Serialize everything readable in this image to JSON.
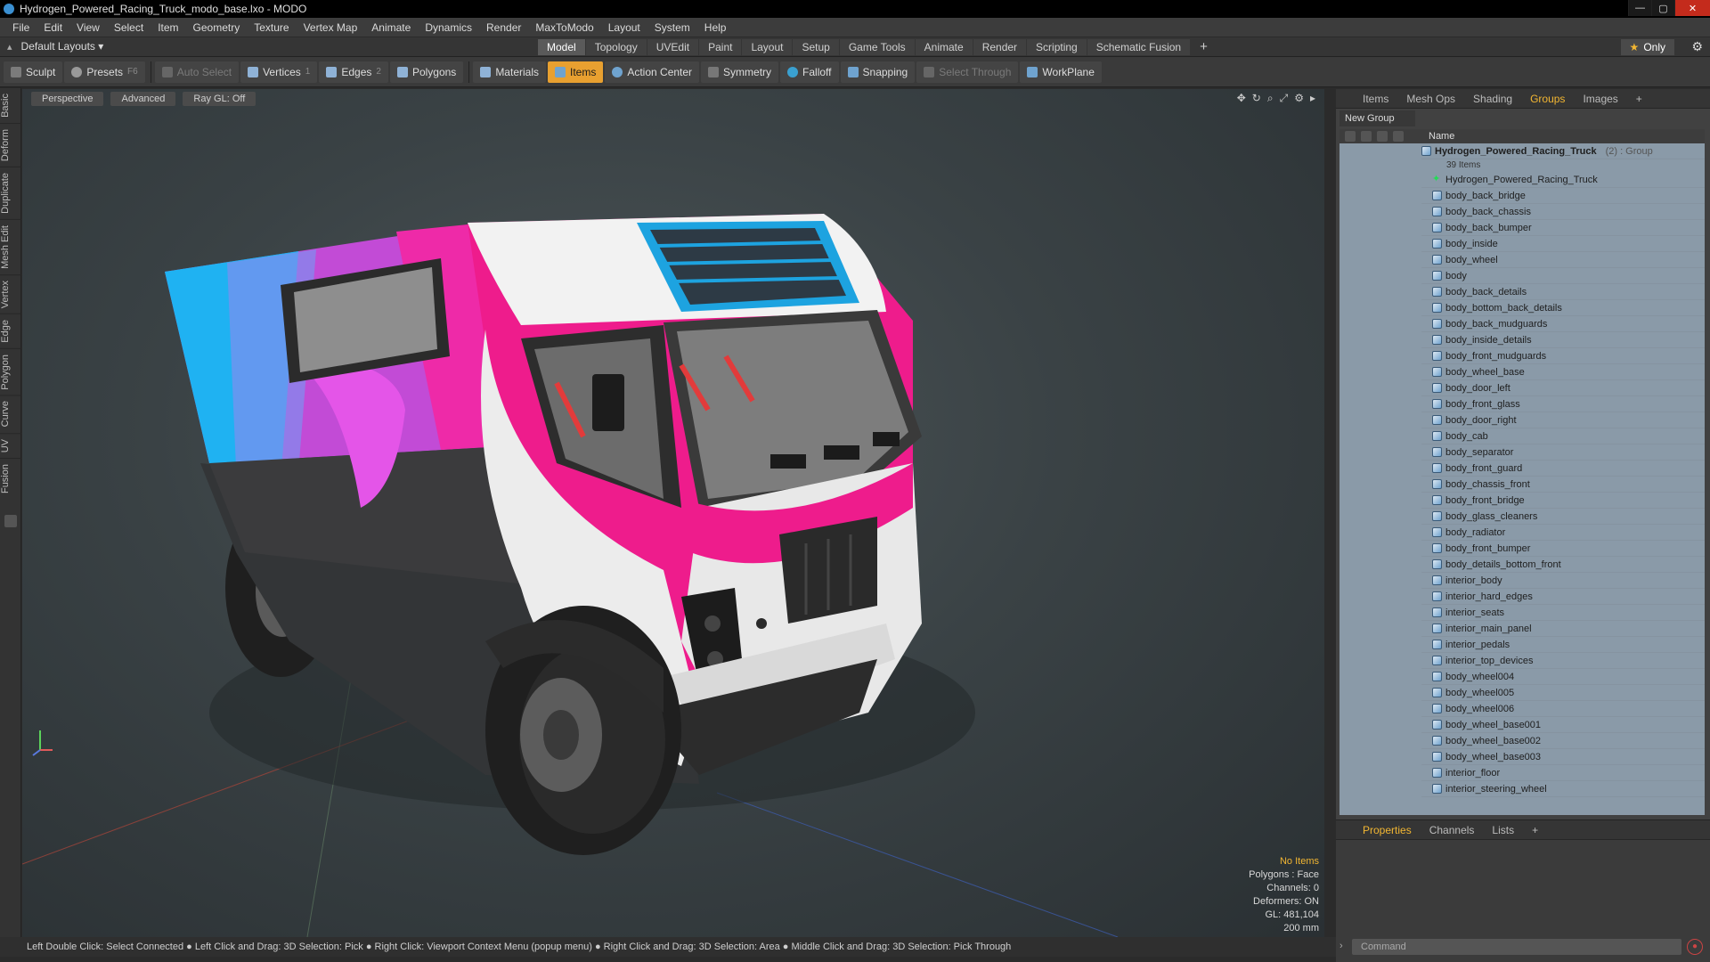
{
  "window": {
    "title": "Hydrogen_Powered_Racing_Truck_modo_base.lxo - MODO",
    "controls": [
      "—",
      "▢",
      "✕"
    ]
  },
  "menu": [
    "File",
    "Edit",
    "View",
    "Select",
    "Item",
    "Geometry",
    "Texture",
    "Vertex Map",
    "Animate",
    "Dynamics",
    "Render",
    "MaxToModo",
    "Layout",
    "System",
    "Help"
  ],
  "layout": {
    "label": "Default Layouts ▾"
  },
  "top_tabs": [
    {
      "label": "Model",
      "active": true
    },
    {
      "label": "Topology"
    },
    {
      "label": "UVEdit"
    },
    {
      "label": "Paint"
    },
    {
      "label": "Layout"
    },
    {
      "label": "Setup"
    },
    {
      "label": "Game Tools"
    },
    {
      "label": "Animate"
    },
    {
      "label": "Render"
    },
    {
      "label": "Scripting"
    },
    {
      "label": "Schematic Fusion"
    }
  ],
  "only_label": "Only",
  "toolbar": {
    "sculpt": "Sculpt",
    "presets": "Presets",
    "presets_key": "F6",
    "auto_select": "Auto Select",
    "vertices": "Vertices",
    "vertices_key": "1",
    "edges": "Edges",
    "edges_key": "2",
    "polygons": "Polygons",
    "materials": "Materials",
    "items": "Items",
    "action_center": "Action Center",
    "symmetry": "Symmetry",
    "falloff": "Falloff",
    "snapping": "Snapping",
    "select_through": "Select Through",
    "workplane": "WorkPlane"
  },
  "left_tabs": [
    "Basic",
    "Deform",
    "Duplicate",
    "Mesh Edit",
    "Vertex",
    "Edge",
    "Polygon",
    "Curve",
    "UV",
    "Fusion"
  ],
  "viewport": {
    "view": "Perspective",
    "advanced": "Advanced",
    "raygl": "Ray GL: Off",
    "info": {
      "no_items": "No Items",
      "polygons": "Polygons : Face",
      "channels": "Channels: 0",
      "deformers": "Deformers: ON",
      "gl": "GL: 481,104",
      "scale": "200 mm"
    }
  },
  "status": "Left Double Click: Select Connected ● Left Click and Drag: 3D Selection: Pick ● Right Click: Viewport Context Menu (popup menu) ● Right Click and Drag: 3D Selection: Area ● Middle Click and Drag: 3D Selection: Pick Through",
  "right_tabs": [
    {
      "label": "Items"
    },
    {
      "label": "Mesh Ops"
    },
    {
      "label": "Shading"
    },
    {
      "label": "Groups",
      "active": true
    },
    {
      "label": "Images"
    }
  ],
  "new_group": "New Group",
  "list_header": "Name",
  "group": {
    "name": "Hydrogen_Powered_Racing_Truck",
    "suffix": "(2) : Group",
    "count": "39 Items"
  },
  "items": [
    "Hydrogen_Powered_Racing_Truck",
    "body_back_bridge",
    "body_back_chassis",
    "body_back_bumper",
    "body_inside",
    "body_wheel",
    "body",
    "body_back_details",
    "body_bottom_back_details",
    "body_back_mudguards",
    "body_inside_details",
    "body_front_mudguards",
    "body_wheel_base",
    "body_door_left",
    "body_front_glass",
    "body_door_right",
    "body_cab",
    "body_separator",
    "body_front_guard",
    "body_chassis_front",
    "body_front_bridge",
    "body_glass_cleaners",
    "body_radiator",
    "body_front_bumper",
    "body_details_bottom_front",
    "interior_body",
    "interior_hard_edges",
    "interior_seats",
    "interior_main_panel",
    "interior_pedals",
    "interior_top_devices",
    "body_wheel004",
    "body_wheel005",
    "body_wheel006",
    "body_wheel_base001",
    "body_wheel_base002",
    "body_wheel_base003",
    "interior_floor",
    "interior_steering_wheel"
  ],
  "prop_tabs": [
    {
      "label": "Properties",
      "active": true
    },
    {
      "label": "Channels"
    },
    {
      "label": "Lists"
    }
  ],
  "command_placeholder": "Command"
}
